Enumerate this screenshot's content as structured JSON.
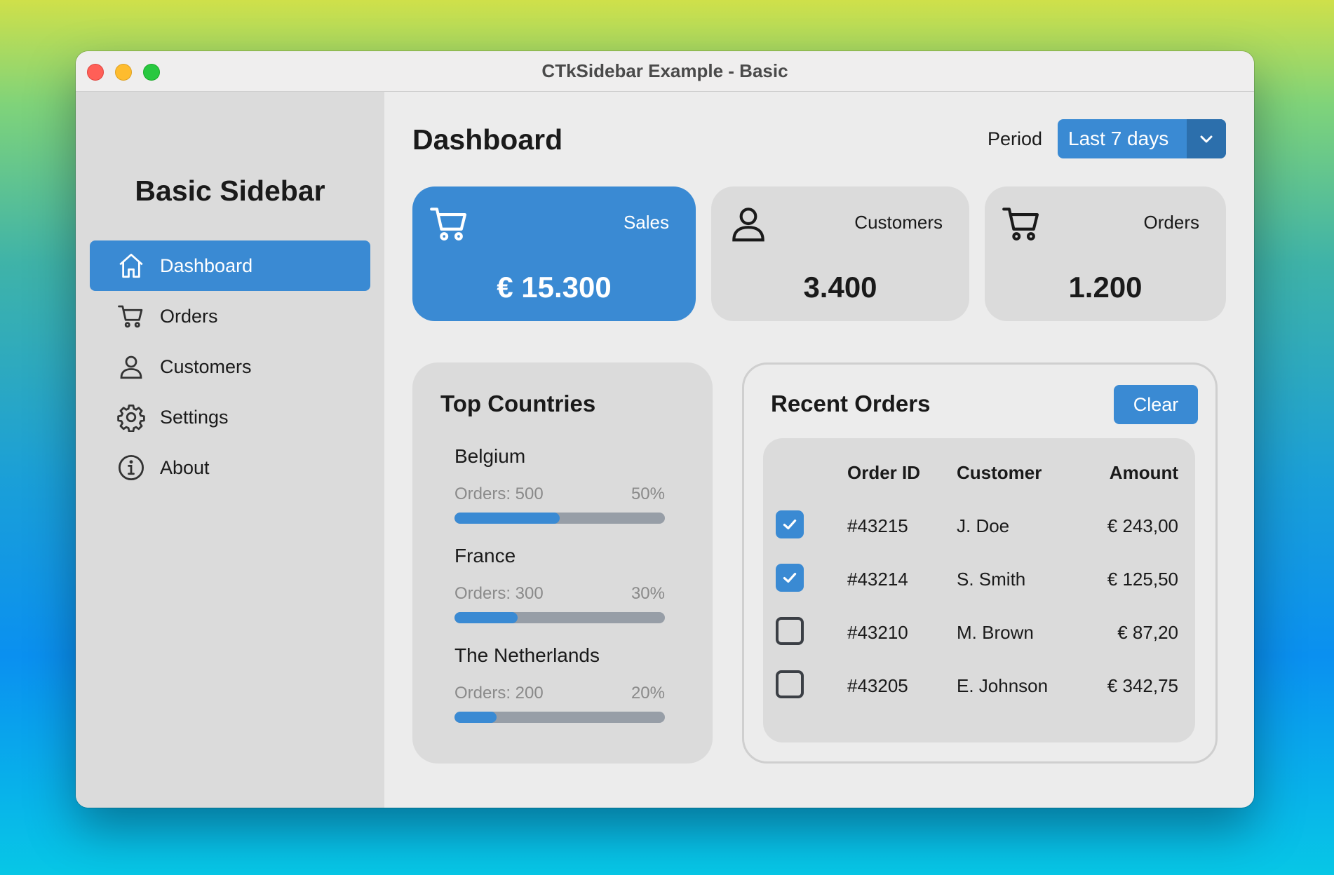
{
  "window": {
    "title": "CTkSidebar Example - Basic"
  },
  "sidebar": {
    "title": "Basic Sidebar",
    "items": [
      {
        "label": "Dashboard",
        "icon": "home-icon",
        "active": true
      },
      {
        "label": "Orders",
        "icon": "cart-icon",
        "active": false
      },
      {
        "label": "Customers",
        "icon": "user-icon",
        "active": false
      },
      {
        "label": "Settings",
        "icon": "gear-icon",
        "active": false
      },
      {
        "label": "About",
        "icon": "info-icon",
        "active": false
      }
    ]
  },
  "header": {
    "title": "Dashboard",
    "period_label": "Period",
    "period_value": "Last 7 days"
  },
  "stats": [
    {
      "label": "Sales",
      "value": "€ 15.300",
      "icon": "cart-icon"
    },
    {
      "label": "Customers",
      "value": "3.400",
      "icon": "user-icon"
    },
    {
      "label": "Orders",
      "value": "1.200",
      "icon": "cart-icon"
    }
  ],
  "top_countries": {
    "title": "Top Countries",
    "items": [
      {
        "name": "Belgium",
        "orders": "Orders: 500",
        "percent": "50%",
        "fraction": 0.5
      },
      {
        "name": "France",
        "orders": "Orders: 300",
        "percent": "30%",
        "fraction": 0.3
      },
      {
        "name": "The Netherlands",
        "orders": "Orders: 200",
        "percent": "20%",
        "fraction": 0.2
      }
    ]
  },
  "recent_orders": {
    "title": "Recent Orders",
    "clear_label": "Clear",
    "columns": [
      "Order ID",
      "Customer",
      "Amount"
    ],
    "rows": [
      {
        "checked": true,
        "id": "#43215",
        "customer": "J. Doe",
        "amount": "€ 243,00"
      },
      {
        "checked": true,
        "id": "#43214",
        "customer": "S. Smith",
        "amount": "€ 125,50"
      },
      {
        "checked": false,
        "id": "#43210",
        "customer": "M. Brown",
        "amount": "€ 87,20"
      },
      {
        "checked": false,
        "id": "#43205",
        "customer": "E. Johnson",
        "amount": "€ 342,75"
      }
    ]
  },
  "colors": {
    "accent": "#3a8ad3",
    "accent_dark": "#2c6fac",
    "panel": "#dbdbdb",
    "track": "#979ea7"
  }
}
